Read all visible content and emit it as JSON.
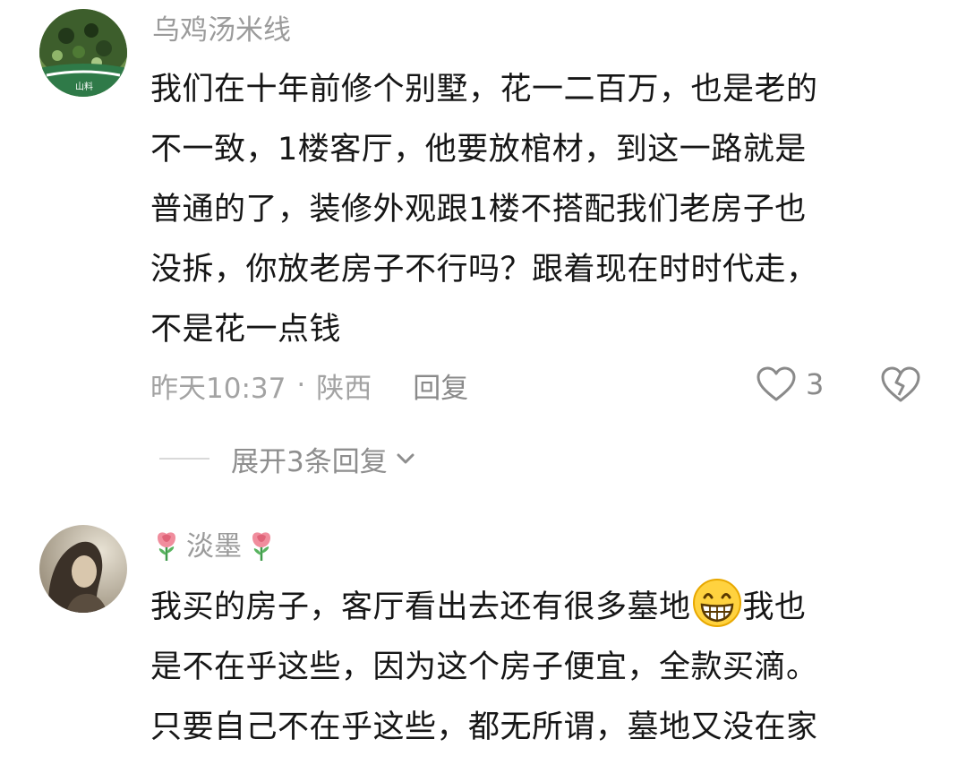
{
  "comments": [
    {
      "username": "乌鸡汤米线",
      "avatar_icon": "noodle-bowl-avatar",
      "lines": [
        "我们在十年前修个别墅，花一二百万，也是老的",
        "不一致，1楼客厅，他要放棺材，到这一路就是",
        "普通的了，装修外观跟1楼不搭配我们老房子也",
        "没拆，你放老房子不行吗？跟着现在时时代走，",
        "不是花一点钱"
      ],
      "time": "昨天10:37",
      "separator": "·",
      "location": "陕西",
      "reply_label": "回复",
      "like_count": "3",
      "like_icon": "heart-icon",
      "dislike_icon": "broken-heart-icon",
      "expand_label": "展开3条回复",
      "expand_icon": "chevron-down-icon"
    },
    {
      "username": "淡墨",
      "avatar_icon": "person-portrait-avatar",
      "username_decoration_icon": "rose-icon",
      "line1_before_emoji": "我买的房子，客厅看出去还有很多墓地",
      "emoji": "grin-icon",
      "line1_after_emoji": "我也",
      "lines": [
        "是不在乎这些，因为这个房子便宜，全款买滴。",
        "只要自己不在乎这些，都无所谓，墓地又没在家"
      ]
    }
  ],
  "colors": {
    "text": "#161616",
    "meta": "#a3a3a3",
    "username": "#9b9b9b",
    "background": "#ffffff"
  }
}
